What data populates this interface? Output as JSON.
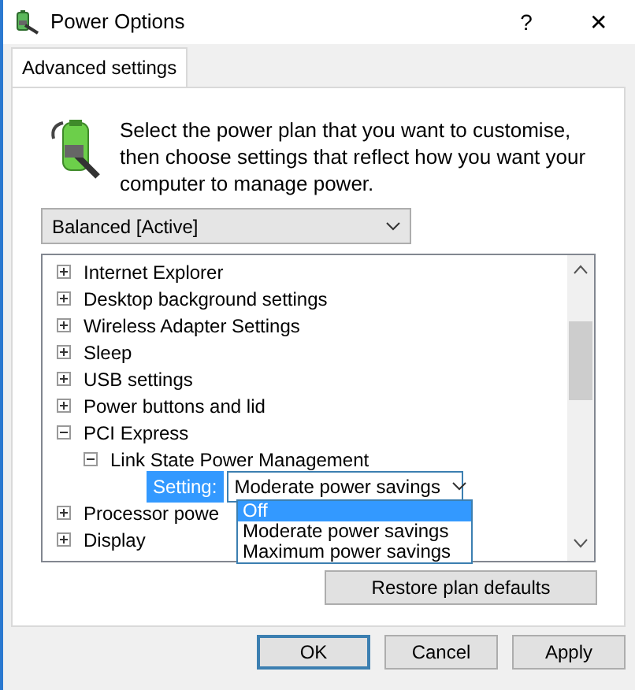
{
  "window": {
    "title": "Power Options",
    "buttons": [
      "?",
      "✕"
    ]
  },
  "tabs": [
    {
      "label": "Advanced settings",
      "selected": true
    }
  ],
  "intro": "Select the power plan that you want to customise, then choose settings that reflect how you want your computer to manage power.",
  "plan": {
    "value": "Balanced [Active]"
  },
  "tree": [
    {
      "label": "Internet Explorer",
      "expanded": false
    },
    {
      "label": "Desktop background settings",
      "expanded": false
    },
    {
      "label": "Wireless Adapter Settings",
      "expanded": false
    },
    {
      "label": "Sleep",
      "expanded": false
    },
    {
      "label": "USB settings",
      "expanded": false
    },
    {
      "label": "Power buttons and lid",
      "expanded": false
    },
    {
      "label": "PCI Express",
      "expanded": true,
      "children": [
        {
          "label": "Link State Power Management",
          "expanded": true,
          "children": [
            {
              "kind": "setting",
              "label": "Setting:",
              "value": "Moderate power savings",
              "expanded": true,
              "options": [
                {
                  "label": "Off",
                  "highlighted": true
                },
                {
                  "label": "Moderate power savings",
                  "highlighted": false
                },
                {
                  "label": "Maximum power savings",
                  "highlighted": false
                }
              ]
            }
          ]
        }
      ]
    },
    {
      "label": "Processor powe",
      "expanded": false
    },
    {
      "label": "Display",
      "expanded": false
    }
  ],
  "restore_button": "Restore plan defaults",
  "buttons": [
    {
      "label": "OK",
      "default": true
    },
    {
      "label": "Cancel",
      "default": false
    },
    {
      "label": "Apply",
      "default": false
    }
  ]
}
